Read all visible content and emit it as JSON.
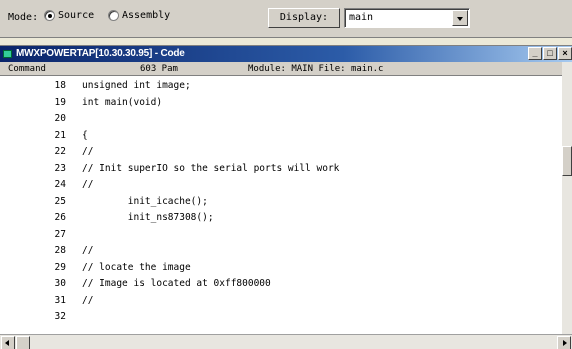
{
  "toolbar": {
    "mode_label": "Mode:",
    "mode_options": [
      {
        "label": "Source",
        "selected": true
      },
      {
        "label": "Assembly",
        "selected": false
      }
    ],
    "display_label": "Display:",
    "display_value": "main"
  },
  "window": {
    "title": "MWXPOWERTAP[10.30.30.95] - Code",
    "buttons": [
      "_",
      "□",
      "×"
    ]
  },
  "infobar": {
    "command": "Command",
    "pos": "603 Pam",
    "module": "Module: MAIN File: main.c"
  },
  "code_lines": [
    {
      "num": "18",
      "text": "unsigned int image;"
    },
    {
      "num": "19",
      "text": "int main(void)"
    },
    {
      "num": "20",
      "text": ""
    },
    {
      "num": "21",
      "text": "{"
    },
    {
      "num": "22",
      "text": "//"
    },
    {
      "num": "23",
      "text": "// Init superIO so the serial ports will work"
    },
    {
      "num": "24",
      "text": "//"
    },
    {
      "num": "25",
      "text": "        init_icache();"
    },
    {
      "num": "26",
      "text": "        init_ns87308();"
    },
    {
      "num": "27",
      "text": ""
    },
    {
      "num": "28",
      "text": "//"
    },
    {
      "num": "29",
      "text": "// locate the image"
    },
    {
      "num": "30",
      "text": "// Image is located at 0xff800000"
    },
    {
      "num": "31",
      "text": "//"
    },
    {
      "num": "32",
      "text": ""
    }
  ]
}
